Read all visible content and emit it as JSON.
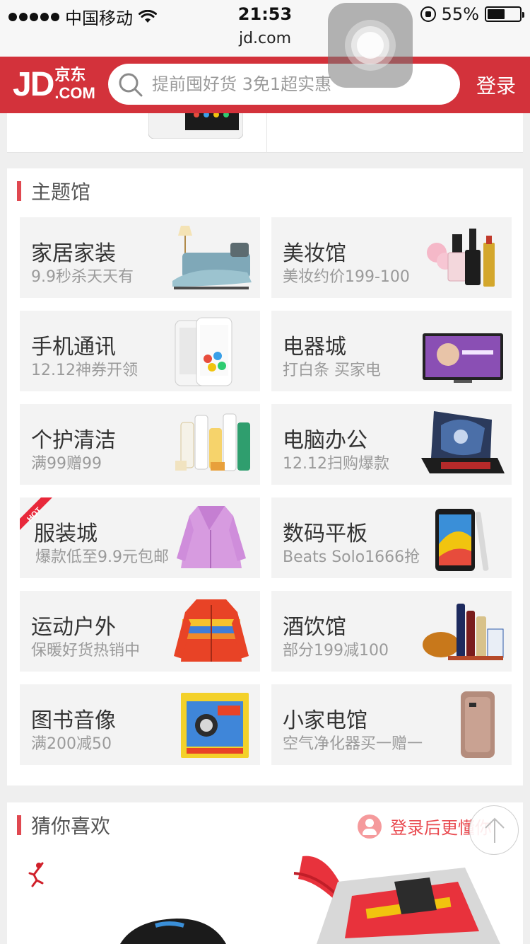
{
  "status_bar": {
    "carrier": "中国移动",
    "time": "21:53",
    "url": "jd.com",
    "battery_text": "55%",
    "battery_level": 0.55
  },
  "header": {
    "logo_text": "JD",
    "logo_cn": "京东",
    "logo_com": ".COM",
    "search_placeholder": "提前囤好货 3免1超实惠",
    "login_label": "登录"
  },
  "theme_section": {
    "title": "主题馆",
    "tiles": [
      {
        "title": "家居家装",
        "subtitle": "9.9秒杀天天有",
        "icon": "bedding-icon"
      },
      {
        "title": "美妆馆",
        "subtitle": "美妆约价199-100",
        "icon": "cosmetics-icon"
      },
      {
        "title": "手机通讯",
        "subtitle": "12.12神券开领",
        "icon": "smartphone-icon"
      },
      {
        "title": "电器城",
        "subtitle": "打白条 买家电",
        "icon": "television-icon"
      },
      {
        "title": "个护清洁",
        "subtitle": "满99赠99",
        "icon": "shampoo-icon"
      },
      {
        "title": "电脑办公",
        "subtitle": "12.12扫购爆款",
        "icon": "laptop-icon"
      },
      {
        "title": "服装城",
        "subtitle": "爆款低至9.9元包邮",
        "icon": "coat-icon",
        "badge": "HOT"
      },
      {
        "title": "数码平板",
        "subtitle": "Beats Solo1666抢",
        "icon": "tablet-icon"
      },
      {
        "title": "运动户外",
        "subtitle": "保暖好货热销中",
        "icon": "down-jacket-icon"
      },
      {
        "title": "酒饮馆",
        "subtitle": "部分199减100",
        "icon": "liquor-icon"
      },
      {
        "title": "图书音像",
        "subtitle": "满200减50",
        "icon": "book-icon"
      },
      {
        "title": "小家电馆",
        "subtitle": "空气净化器买一赠一",
        "icon": "air-purifier-icon"
      }
    ]
  },
  "guess_section": {
    "title": "猜你喜欢",
    "login_hint": "登录后更懂你"
  },
  "colors": {
    "brand_red": "#d3323b",
    "accent_red": "#e04850",
    "tile_bg": "#f3f3f3"
  }
}
